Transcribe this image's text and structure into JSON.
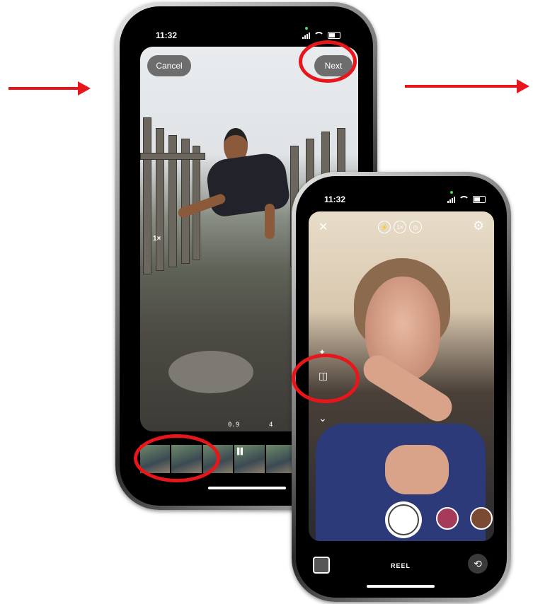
{
  "phone_left": {
    "status_time": "11:32",
    "cancel_label": "Cancel",
    "next_label": "Next",
    "zoom_label": "1×",
    "speed_label": "0.9",
    "speed_label2": "4",
    "scrubber_icon": "clip-trim-handle-icon"
  },
  "phone_right": {
    "status_time": "11:32",
    "close_icon": "close-icon",
    "flash_icon": "flash-off-icon",
    "zoom_label": "1×",
    "timer_icon": "timer-icon",
    "settings_icon": "settings-icon",
    "effects_icon": "sparkle-icon",
    "layout_icon": "split-screen-icon",
    "more_icon": "chevron-down-icon",
    "mode_label": "REEL"
  },
  "colors": {
    "highlight": "#e8161b",
    "button_gray": "#6d6d6d"
  }
}
